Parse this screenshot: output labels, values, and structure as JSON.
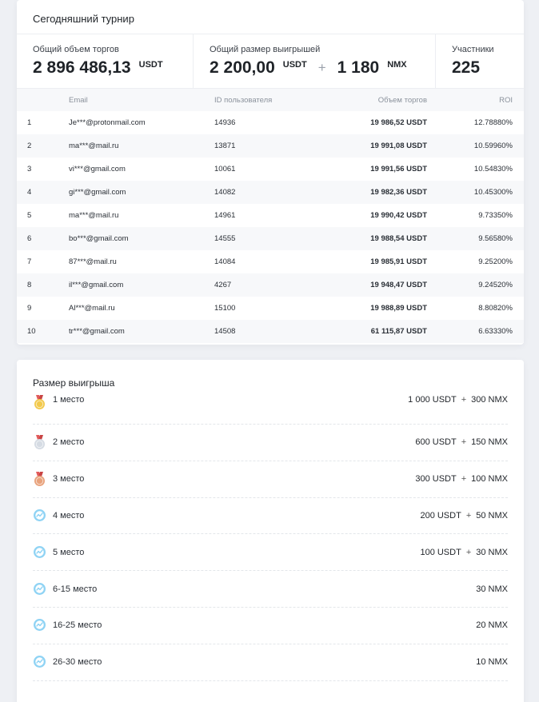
{
  "tournament": {
    "title": "Сегодняшний турнир",
    "stats": {
      "volume_label": "Общий объем торгов",
      "volume_value": "2 896 486,13",
      "volume_unit": "USDT",
      "prize_label": "Общий размер выигрышей",
      "prize_usdt_value": "2 200,00",
      "prize_usdt_unit": "USDT",
      "prize_plus": "+",
      "prize_nmx_value": "1 180",
      "prize_nmx_unit": "NMX",
      "participants_label": "Участники",
      "participants_value": "225"
    },
    "table": {
      "headers": {
        "rank": "",
        "email": "Email",
        "id": "ID пользователя",
        "volume": "Объем торгов",
        "roi": "ROI"
      },
      "rows": [
        {
          "rank": "1",
          "email": "Je***@protonmail.com",
          "id": "14936",
          "volume": "19 986,52 USDT",
          "roi": "12.78880%"
        },
        {
          "rank": "2",
          "email": "ma***@mail.ru",
          "id": "13871",
          "volume": "19 991,08 USDT",
          "roi": "10.59960%"
        },
        {
          "rank": "3",
          "email": "vi***@gmail.com",
          "id": "10061",
          "volume": "19 991,56 USDT",
          "roi": "10.54830%"
        },
        {
          "rank": "4",
          "email": "gi***@gmail.com",
          "id": "14082",
          "volume": "19 982,36 USDT",
          "roi": "10.45300%"
        },
        {
          "rank": "5",
          "email": "ma***@mail.ru",
          "id": "14961",
          "volume": "19 990,42 USDT",
          "roi": "9.73350%"
        },
        {
          "rank": "6",
          "email": "bo***@gmail.com",
          "id": "14555",
          "volume": "19 988,54 USDT",
          "roi": "9.56580%"
        },
        {
          "rank": "7",
          "email": "87***@mail.ru",
          "id": "14084",
          "volume": "19 985,91 USDT",
          "roi": "9.25200%"
        },
        {
          "rank": "8",
          "email": "il***@gmail.com",
          "id": "4267",
          "volume": "19 948,47 USDT",
          "roi": "9.24520%"
        },
        {
          "rank": "9",
          "email": "Al***@mail.ru",
          "id": "15100",
          "volume": "19 988,89 USDT",
          "roi": "8.80820%"
        },
        {
          "rank": "10",
          "email": "tr***@gmail.com",
          "id": "14508",
          "volume": "61 115,87 USDT",
          "roi": "6.63330%"
        }
      ]
    }
  },
  "prize": {
    "title": "Размер выигрыша",
    "rows": [
      {
        "icon": "gold-medal-icon",
        "place": "1 место",
        "usdt": "1 000 USDT",
        "sep": "+",
        "nmx": "300 NMX"
      },
      {
        "icon": "silver-medal-icon",
        "place": "2 место",
        "usdt": "600 USDT",
        "sep": "+",
        "nmx": "150 NMX"
      },
      {
        "icon": "bronze-medal-icon",
        "place": "3 место",
        "usdt": "300 USDT",
        "sep": "+",
        "nmx": "100 NMX"
      },
      {
        "icon": "chart-badge-icon",
        "place": "4 место",
        "usdt": "200 USDT",
        "sep": "+",
        "nmx": "50 NMX"
      },
      {
        "icon": "chart-badge-icon",
        "place": "5 место",
        "usdt": "100 USDT",
        "sep": "+",
        "nmx": "30 NMX"
      },
      {
        "icon": "chart-badge-icon",
        "place": "6-15 место",
        "usdt": "",
        "sep": "",
        "nmx": "30 NMX"
      },
      {
        "icon": "chart-badge-icon",
        "place": "16-25 место",
        "usdt": "",
        "sep": "",
        "nmx": "20 NMX"
      },
      {
        "icon": "chart-badge-icon",
        "place": "26-30 место",
        "usdt": "",
        "sep": "",
        "nmx": "10 NMX"
      }
    ]
  },
  "colors": {
    "background": "#eef0f4",
    "card": "#ffffff",
    "gold": "#f2c94c",
    "silver": "#d5dbe3",
    "bronze": "#e8a27c",
    "badge": "#8fd3f4"
  }
}
